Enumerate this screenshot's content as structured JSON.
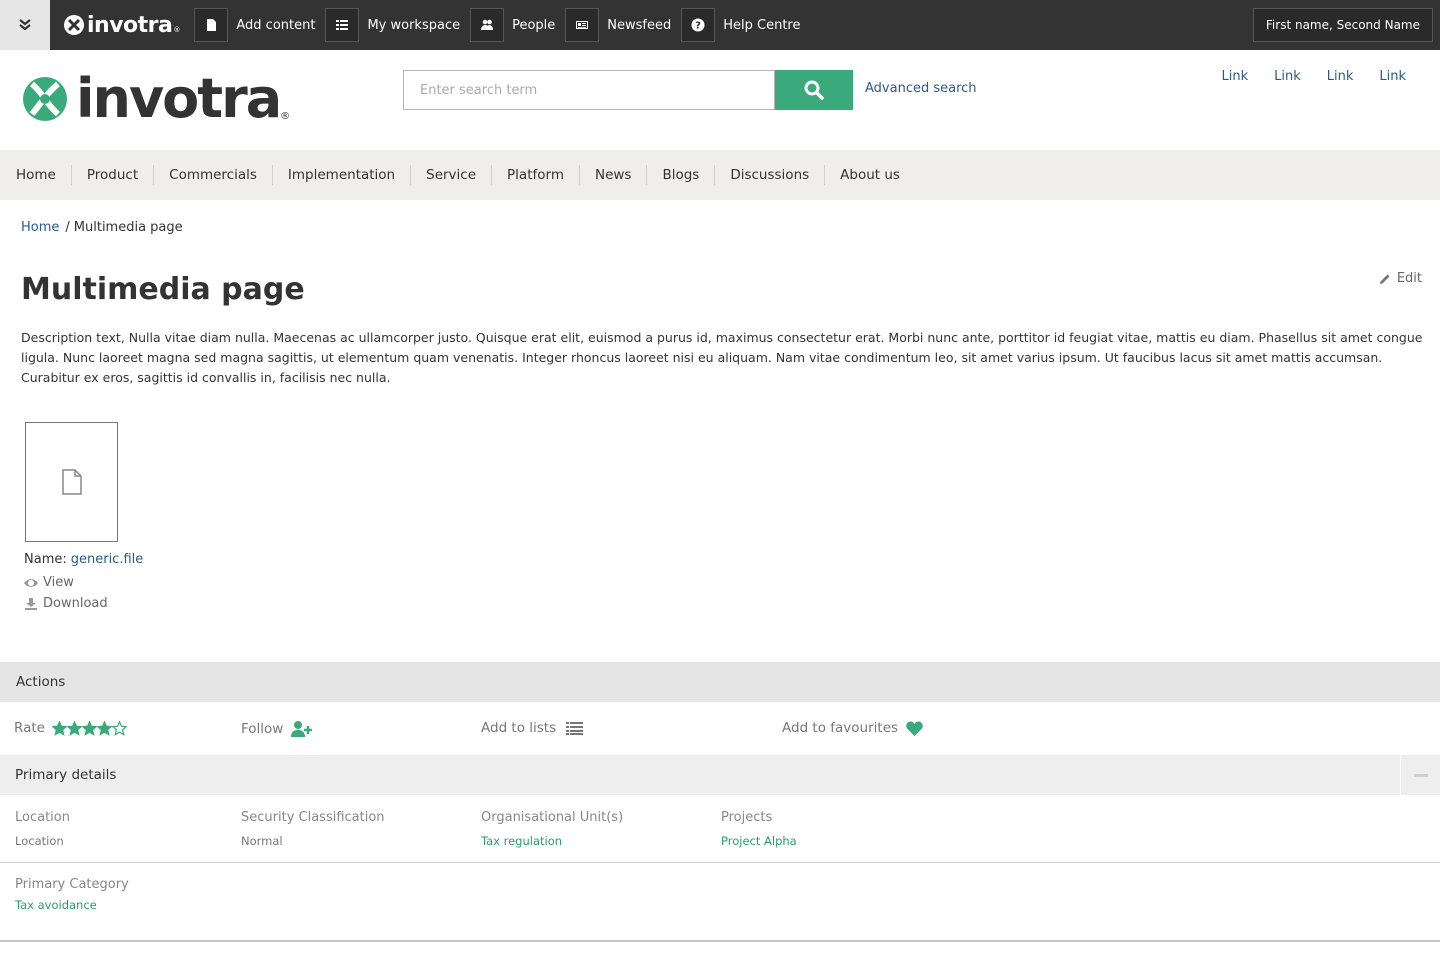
{
  "topbar": {
    "brand": "invotra",
    "brand_reg": "®",
    "items": [
      {
        "label": "Add content",
        "icon": "document-icon"
      },
      {
        "label": "My workspace",
        "icon": "list-icon"
      },
      {
        "label": "People",
        "icon": "people-icon"
      },
      {
        "label": "Newsfeed",
        "icon": "newspaper-icon"
      },
      {
        "label": "Help Centre",
        "icon": "help-icon"
      }
    ],
    "user_name": "First name, Second Name"
  },
  "header": {
    "brand": "invotra",
    "brand_reg": "®",
    "search_placeholder": "Enter search term",
    "advanced_search": "Advanced search",
    "links": [
      "Link",
      "Link",
      "Link",
      "Link"
    ]
  },
  "nav": [
    "Home",
    "Product",
    "Commercials",
    "Implementation",
    "Service",
    "Platform",
    "News",
    "Blogs",
    "Discussions",
    "About us"
  ],
  "breadcrumb": {
    "home": "Home",
    "separator": "/",
    "current": "Multimedia page"
  },
  "page": {
    "title": "Multimedia page",
    "edit": "Edit",
    "description": "Description text, Nulla vitae diam nulla. Maecenas ac ullamcorper justo. Quisque erat elit, euismod a purus id, maximus consectetur erat. Morbi nunc ante, porttitor id feugiat vitae, mattis eu diam. Phasellus sit amet congue ligula. Nunc laoreet magna sed magna sagittis, ut elementum quam venenatis. Integer rhoncus laoreet nisi eu aliquam. Nam vitae condimentum leo, sit amet varius ipsum. Ut faucibus lacus sit amet mattis accumsan. Curabitur ex eros, sagittis id convallis in, facilisis nec nulla."
  },
  "file": {
    "name_label": "Name:",
    "name": "generic.file",
    "view": "View",
    "download": "Download"
  },
  "actions": {
    "title": "Actions",
    "rate": "Rate",
    "rating": 4,
    "rating_max": 5,
    "follow": "Follow",
    "add_to_lists": "Add to lists",
    "add_to_favourites": "Add to favourites"
  },
  "primary_details": {
    "title": "Primary details",
    "location_label": "Location",
    "location_value": "Location",
    "security_label": "Security Classification",
    "security_value": "Normal",
    "org_label": "Organisational Unit(s)",
    "org_value": "Tax regulation",
    "projects_label": "Projects",
    "projects_value": "Project Alpha",
    "category_label": "Primary Category",
    "category_value": "Tax avoidance"
  },
  "colors": {
    "accent": "#3aaa7c",
    "link": "#2b5b8a",
    "topbar": "#333333"
  }
}
